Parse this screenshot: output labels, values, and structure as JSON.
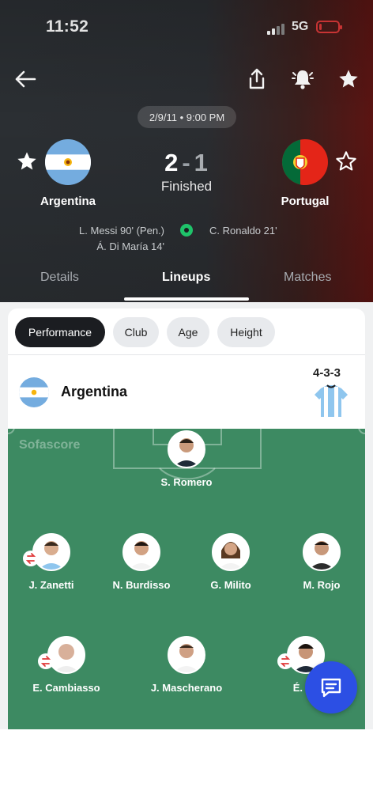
{
  "status_bar": {
    "time": "11:52",
    "network": "5G",
    "battery_level": 0.12
  },
  "match": {
    "date_time": "2/9/11 • 9:00 PM",
    "home": {
      "name": "Argentina",
      "score": "2",
      "scorers": [
        "L. Messi 90' (Pen.)",
        "Á. Di María 14'"
      ]
    },
    "away": {
      "name": "Portugal",
      "score": "1",
      "scorers": [
        "C. Ronaldo 21'"
      ]
    },
    "separator": "-",
    "status": "Finished"
  },
  "tabs": {
    "details": "Details",
    "lineups": "Lineups",
    "matches": "Matches",
    "active": "lineups"
  },
  "lineups": {
    "filters": [
      "Performance",
      "Club",
      "Age",
      "Height"
    ],
    "active_filter": "Performance",
    "team": {
      "name": "Argentina",
      "formation": "4-3-3"
    },
    "watermark": "Sofascore",
    "players": {
      "gk": "S. Romero",
      "def1": "J. Zanetti",
      "def2": "N. Burdisso",
      "def3": "G. Milito",
      "def4": "M. Rojo",
      "mid1": "E. Cambiasso",
      "mid2": "J. Mascherano",
      "mid3": "É. Ba"
    }
  },
  "colors": {
    "pitch": "#3d8a62",
    "accent": "#2c4fe4",
    "active_chip": "#1b1d21"
  },
  "icons": [
    "back-icon",
    "share-icon",
    "bell-icon",
    "star-icon",
    "ball-icon",
    "substitution-icon",
    "chat-icon"
  ]
}
